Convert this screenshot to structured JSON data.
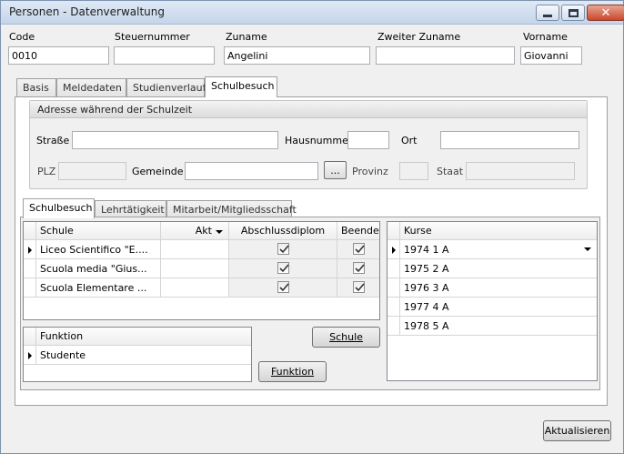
{
  "window": {
    "title": "Personen - Datenverwaltung",
    "close_glyph": "✕"
  },
  "person": {
    "code_label": "Code",
    "code_value": "0010",
    "steuer_label": "Steuernummer",
    "steuer_value": "",
    "zuname_label": "Zuname",
    "zuname_value": "Angelini",
    "zweiter_label": "Zweiter Zuname",
    "zweiter_value": "",
    "vorname_label": "Vorname",
    "vorname_value": "Giovanni"
  },
  "main_tabs": [
    "Basis",
    "Meldedaten",
    "Studienverlauf",
    "Schulbesuch"
  ],
  "address": {
    "header": "Adresse während der Schulzeit",
    "strasse_label": "Straße",
    "strasse_value": "",
    "hausnummer_label": "Hausnummer",
    "hausnummer_value": "",
    "ort_label": "Ort",
    "ort_value": "",
    "plz_label": "PLZ",
    "gemeinde_label": "Gemeinde",
    "gemeinde_value": "",
    "ellipsis": "...",
    "provinz_label": "Provinz",
    "staat_label": "Staat"
  },
  "sub_tabs": [
    "Schulbesuch",
    "Lehrtätigkeit",
    "Mitarbeit/Mitgliedsschaft"
  ],
  "schulen_grid": {
    "columns": [
      "Schule",
      "Akt",
      "Abschlussdiplom",
      "Beendet"
    ],
    "rows": [
      {
        "schule": "Liceo Scientifico \"E....",
        "akt": "",
        "abschlussdiplom": true,
        "beendet": true
      },
      {
        "schule": "Scuola media \"Gius...",
        "akt": "",
        "abschlussdiplom": true,
        "beendet": true
      },
      {
        "schule": "Scuola Elementare ...",
        "akt": "",
        "abschlussdiplom": true,
        "beendet": true
      }
    ]
  },
  "kurse_grid": {
    "column": "Kurse",
    "rows": [
      "1974 1 A",
      "1975 2 A",
      "1976 3 A",
      "1977 4 A",
      "1978 5 A"
    ]
  },
  "funktion_grid": {
    "column": "Funktion",
    "rows": [
      "Studente"
    ]
  },
  "buttons": {
    "schule": "Schule",
    "funktion": "Funktion",
    "aktualisieren": "Aktualisieren"
  }
}
